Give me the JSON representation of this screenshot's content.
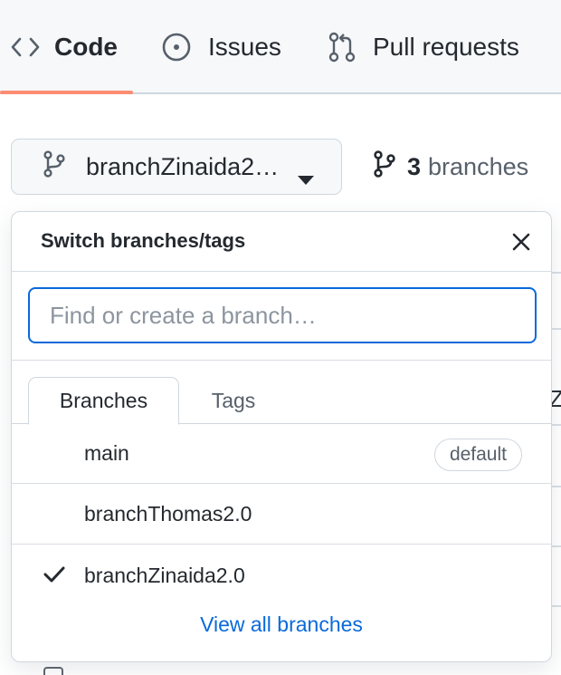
{
  "nav": {
    "tabs": [
      {
        "label": "Code",
        "icon": "code-icon"
      },
      {
        "label": "Issues",
        "icon": "issue-opened-icon"
      },
      {
        "label": "Pull requests",
        "icon": "git-pull-request-icon"
      }
    ],
    "active_tab": "Code",
    "active_underline_color": "#fd8c73"
  },
  "branch_selector": {
    "current_branch": "branchZinaida2…",
    "icon": "git-branch-icon"
  },
  "branches_link": {
    "count": "3",
    "label": "branches",
    "icon": "git-branch-icon"
  },
  "background": {
    "fragment": "Zi"
  },
  "dropdown": {
    "title": "Switch branches/tags",
    "filter": {
      "placeholder": "Find or create a branch…",
      "value": ""
    },
    "tabs": [
      {
        "label": "Branches",
        "active": true
      },
      {
        "label": "Tags",
        "active": false
      }
    ],
    "branches": [
      {
        "name": "main",
        "badge": "default",
        "selected": false
      },
      {
        "name": "branchThomas2.0",
        "badge": "",
        "selected": false
      },
      {
        "name": "branchZinaida2.0",
        "badge": "",
        "selected": true
      }
    ],
    "view_all_label": "View all branches",
    "accent_color": "#0969da"
  }
}
